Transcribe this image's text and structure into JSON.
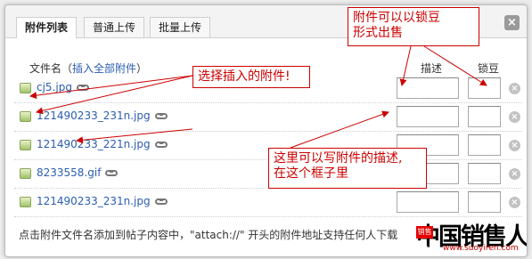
{
  "tabs": [
    {
      "label": "附件列表"
    },
    {
      "label": "普通上传"
    },
    {
      "label": "批量上传"
    }
  ],
  "close_label": "×",
  "columns": {
    "file_prefix": "文件名（",
    "insert_all": "插入全部附件",
    "file_suffix": "）",
    "desc": "描述",
    "lock": "锁豆"
  },
  "files": [
    {
      "name": "cj5.jpg"
    },
    {
      "name": "121490233_231n.jpg"
    },
    {
      "name": "121490233_221n.jpg"
    },
    {
      "name": "8233558.gif"
    },
    {
      "name": "121490233_231n.jpg"
    }
  ],
  "delete_label": "×",
  "footer": "点击附件文件名添加到帖子内容中，\"attach://\" 开头的附件地址支持任何人下载",
  "annotations": {
    "lock": "附件可以以锁豆\n形式出售",
    "insert": "选择插入的附件!",
    "desc": "这里可以写附件的描述,\n在这个框子里"
  },
  "watermark": {
    "text": "中国销售人",
    "seal": "销售人",
    "url": "www.suoyiren.com"
  },
  "colors": {
    "annotation": "#cc0000",
    "link": "#2a5db0"
  }
}
